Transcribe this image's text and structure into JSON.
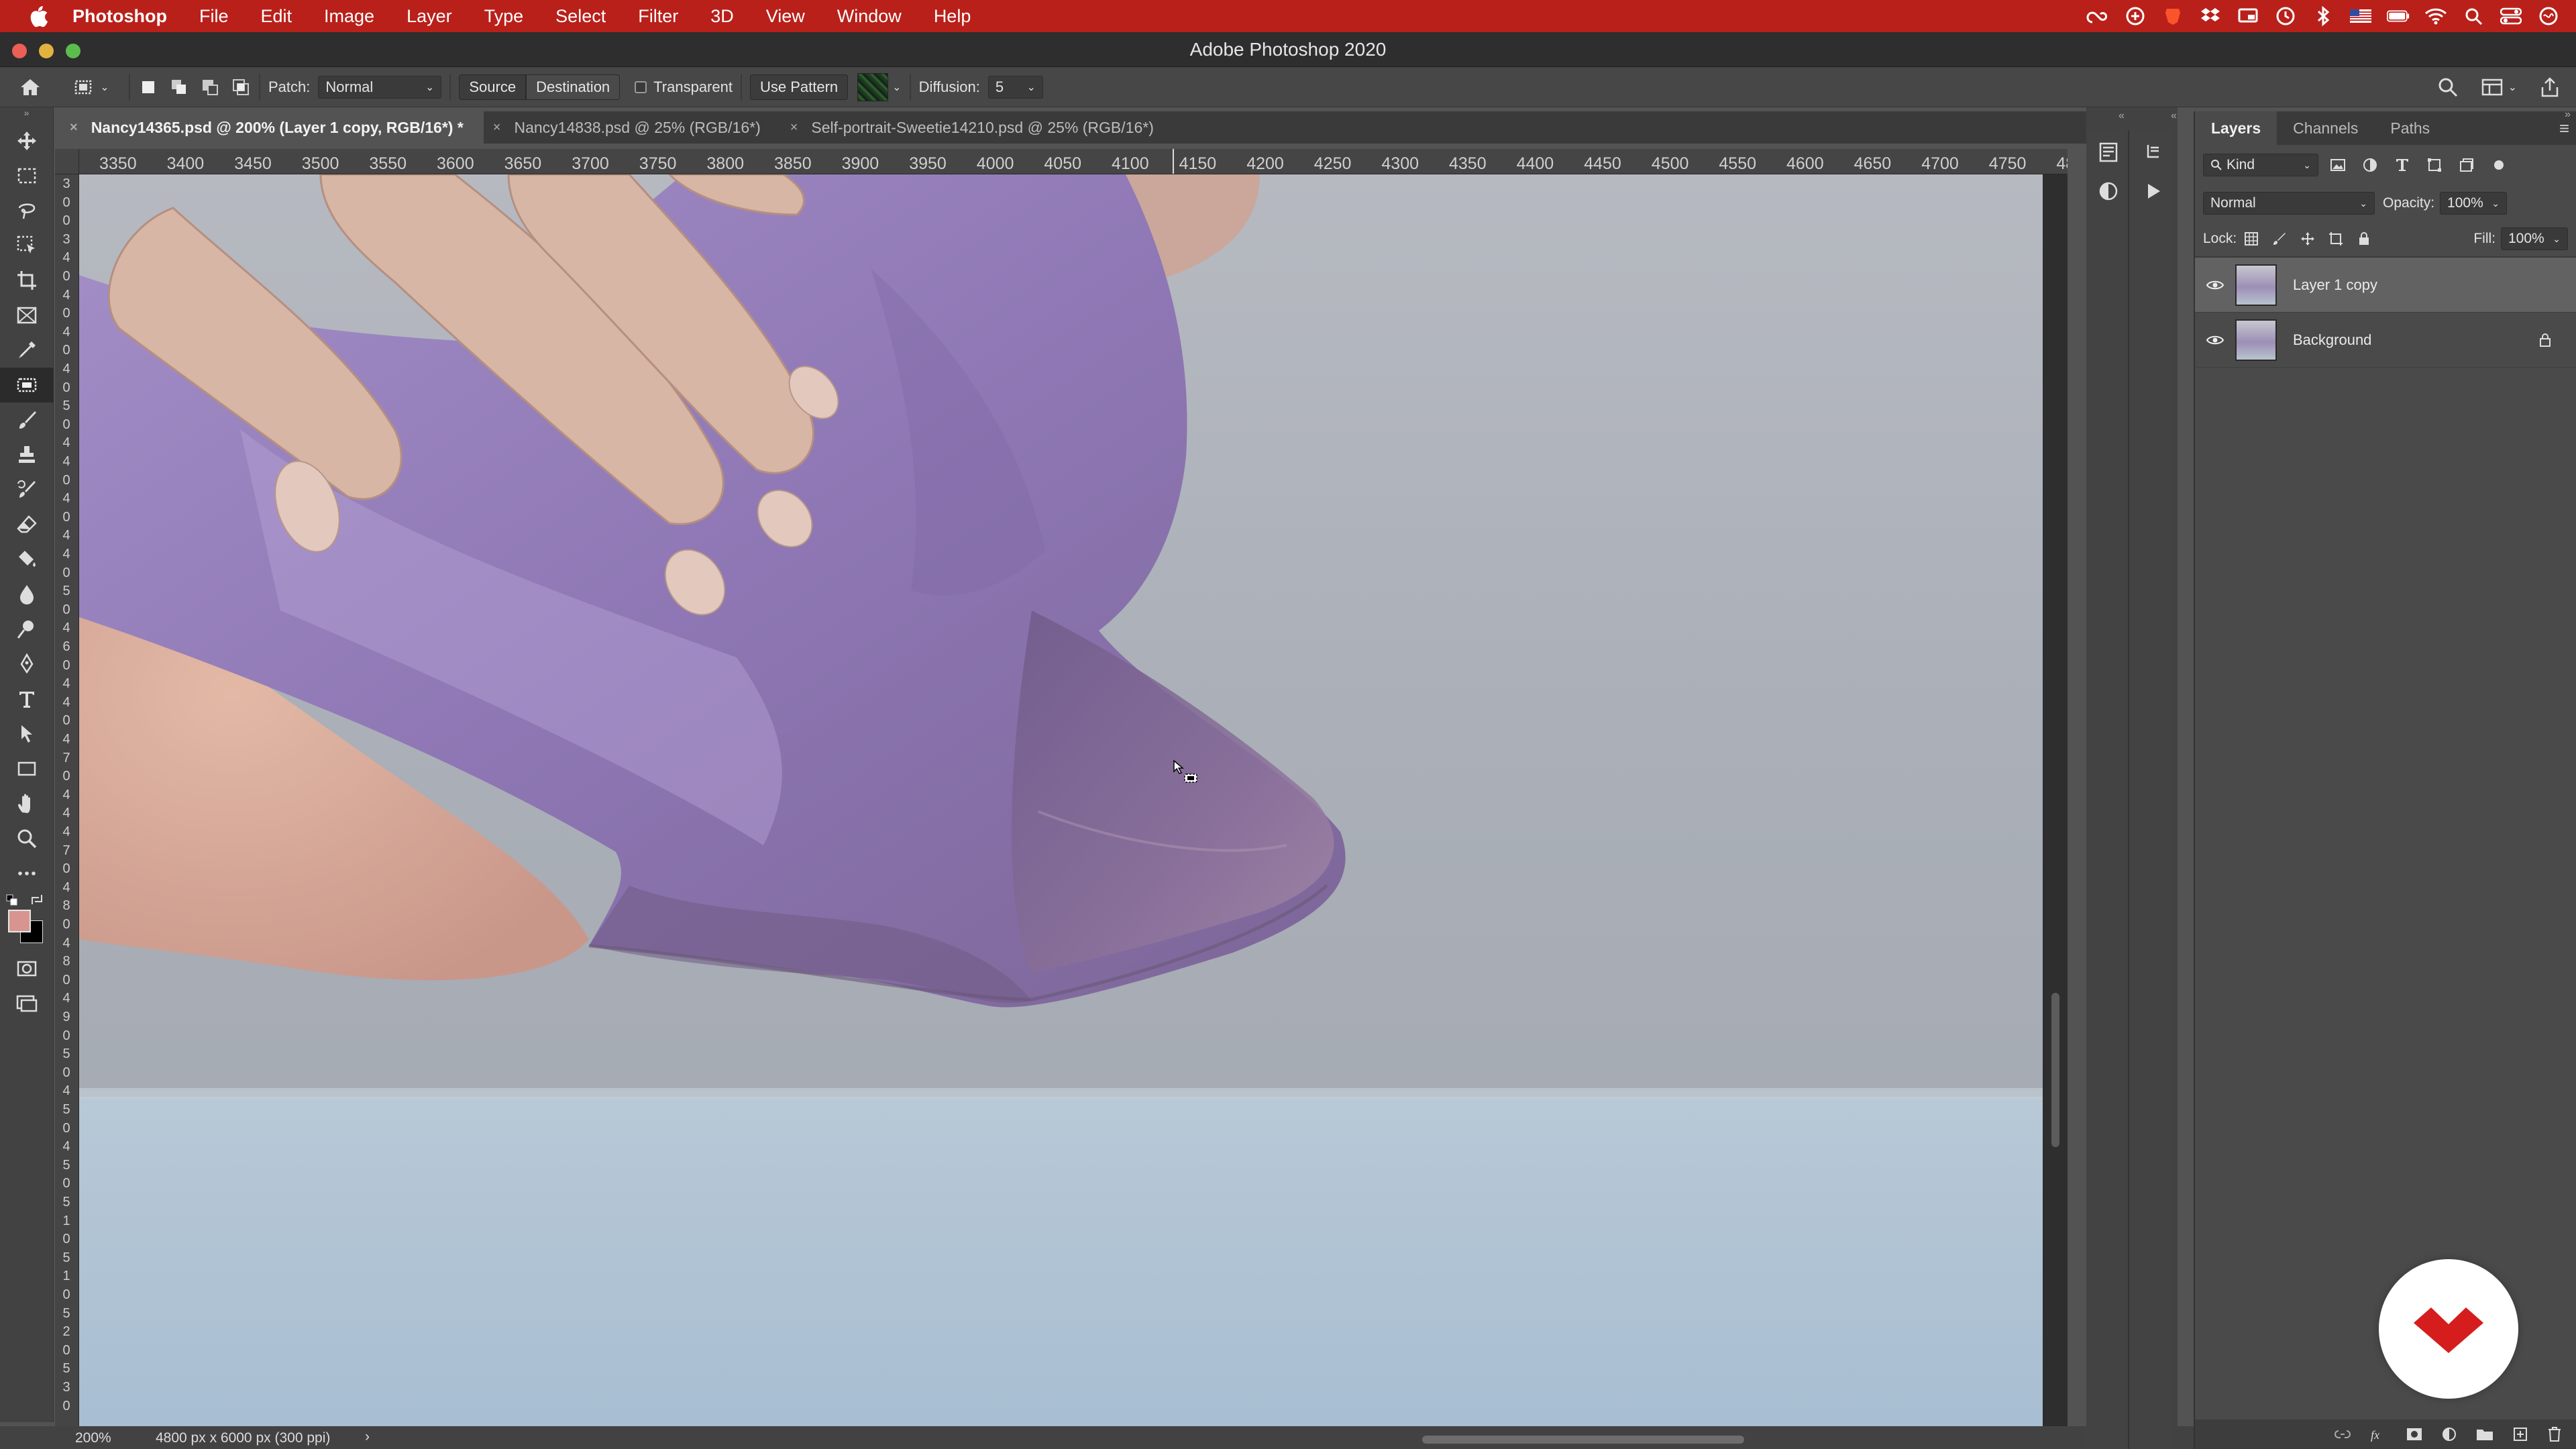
{
  "menubar": {
    "app_name": "Photoshop",
    "items": [
      "File",
      "Edit",
      "Image",
      "Layer",
      "Type",
      "Select",
      "Filter",
      "3D",
      "View",
      "Window",
      "Help"
    ],
    "status_icons": [
      "creative-cloud-icon",
      "sync-icon",
      "brave-icon",
      "dropbox-icon",
      "display-icon",
      "time-machine-icon",
      "bluetooth-icon",
      "flag-icon",
      "battery-icon",
      "wifi-icon",
      "spotlight-icon",
      "control-center-icon",
      "siri-icon"
    ]
  },
  "window": {
    "title": "Adobe Photoshop 2020"
  },
  "options": {
    "patch_label": "Patch:",
    "patch_mode": "Normal",
    "source_label": "Source",
    "destination_label": "Destination",
    "transparent_label": "Transparent",
    "use_pattern_label": "Use Pattern",
    "diffusion_label": "Diffusion:",
    "diffusion_value": "5"
  },
  "tabs": [
    {
      "label": "Nancy14365.psd @ 200% (Layer 1 copy, RGB/16*) *",
      "active": true
    },
    {
      "label": "Nancy14838.psd @ 25% (RGB/16*)",
      "active": false
    },
    {
      "label": "Self-portrait-Sweetie14210.psd @ 25% (RGB/16*)",
      "active": false
    }
  ],
  "ruler_h": [
    "3350",
    "3400",
    "3450",
    "3500",
    "3550",
    "3600",
    "3650",
    "3700",
    "3750",
    "3800",
    "3850",
    "3900",
    "3950",
    "4000",
    "4050",
    "4100",
    "4150",
    "4200",
    "4250",
    "4300",
    "4350",
    "4400",
    "4450",
    "4500",
    "4550",
    "4600",
    "4650",
    "4700",
    "4750",
    "48"
  ],
  "ruler_v": [
    "3",
    "0",
    "0",
    "3",
    "4",
    "0",
    "4",
    "0",
    "4",
    "0",
    "4",
    "0",
    "5",
    "0",
    "4",
    "4",
    "0",
    "4",
    "0",
    "4",
    "4",
    "0",
    "5",
    "0",
    "4",
    "6",
    "0",
    "4",
    "4",
    "0",
    "4",
    "7",
    "0",
    "4",
    "4",
    "4",
    "7",
    "0",
    "4",
    "8",
    "0",
    "4",
    "8",
    "0",
    "4",
    "9",
    "0",
    "5",
    "0",
    "4",
    "5",
    "0",
    "4",
    "5",
    "0",
    "5",
    "1",
    "0",
    "5",
    "1",
    "0",
    "5",
    "2",
    "0",
    "5",
    "3",
    "0"
  ],
  "status": {
    "zoom": "200%",
    "doc_size": "4800 px x 6000 px (300 ppi)",
    "arrow": "›"
  },
  "layers_panel": {
    "tabs": [
      "Layers",
      "Channels",
      "Paths"
    ],
    "active_tab": "Layers",
    "filter_kind": "Kind",
    "blend_mode": "Normal",
    "opacity_label": "Opacity:",
    "opacity_value": "100%",
    "lock_label": "Lock:",
    "fill_label": "Fill:",
    "fill_value": "100%",
    "layers": [
      {
        "name": "Layer 1 copy",
        "selected": true,
        "locked": false
      },
      {
        "name": "Background",
        "selected": false,
        "locked": true
      }
    ]
  },
  "colors": {
    "menubar": "#b9201a",
    "foreground": "#d8958f",
    "background": "#000000",
    "selected_layer": "#626262",
    "logo_red": "#d51d1d"
  }
}
